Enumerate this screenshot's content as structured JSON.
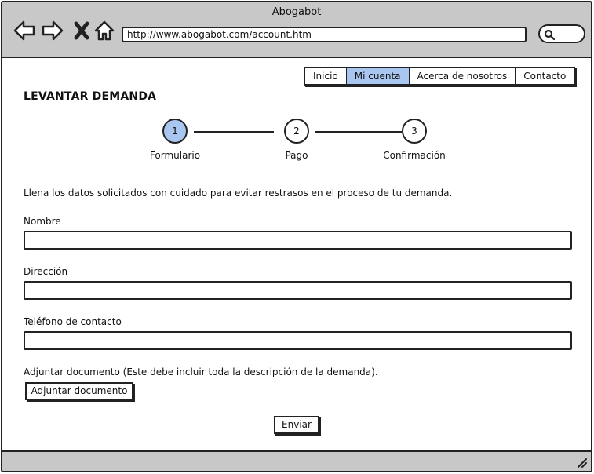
{
  "window": {
    "title": "Abogabot"
  },
  "browser": {
    "url": "http://www.abogabot.com/account.htm",
    "nav_icons": [
      "back-icon",
      "forward-icon",
      "close-icon",
      "home-icon"
    ],
    "search_icon": "search-icon"
  },
  "menu": {
    "items": [
      {
        "label": "Inicio"
      },
      {
        "label": "Mi cuenta",
        "active": true
      },
      {
        "label": "Acerca de nosotros"
      },
      {
        "label": "Contacto"
      }
    ]
  },
  "page": {
    "title": "LEVANTAR DEMANDA"
  },
  "steps": [
    {
      "number": "1",
      "label": "Formulario",
      "active": true
    },
    {
      "number": "2",
      "label": "Pago"
    },
    {
      "number": "3",
      "label": "Confirmación"
    }
  ],
  "form": {
    "intro": "Llena los datos solicitados con cuidado para evitar restrasos en el proceso de tu demanda.",
    "fields": [
      {
        "label": "Nombre",
        "value": ""
      },
      {
        "label": "Dirección",
        "value": ""
      },
      {
        "label": "Teléfono de contacto",
        "value": ""
      }
    ],
    "attach_label": "Adjuntar documento (Este debe incluir toda la descripción de la demanda).",
    "attach_button": "Adjuntar documento",
    "submit_button": "Enviar"
  },
  "colors": {
    "chrome": "#c8c8c8",
    "accent": "#a8c6f0",
    "stroke": "#222222"
  }
}
